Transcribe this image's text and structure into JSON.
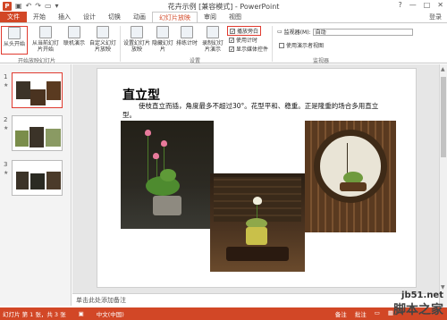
{
  "window": {
    "title": "花卉示例 [兼容模式] - PowerPoint",
    "help": "?",
    "minimize": "—",
    "restore": "□",
    "close": "✕"
  },
  "tabs": [
    {
      "label": "文件"
    },
    {
      "label": "开始"
    },
    {
      "label": "插入"
    },
    {
      "label": "设计"
    },
    {
      "label": "切换"
    },
    {
      "label": "动画"
    },
    {
      "label": "幻灯片放映"
    },
    {
      "label": "审阅"
    },
    {
      "label": "视图"
    }
  ],
  "login": "登录",
  "ribbon": {
    "from_beginning": "从头开始",
    "from_current": "从当前幻灯片开始",
    "online_present": "联机演示",
    "custom_show": "自定义幻灯片放映",
    "setup_show": "设置幻灯片放映",
    "hide_slide": "隐藏幻灯片",
    "rehearse": "排练计时",
    "record": "录制幻灯片演示",
    "play_narration": "播放旁白",
    "use_timings": "使用计时",
    "show_media_controls": "显示媒体控件",
    "monitor_label": "监视器(M):",
    "monitor_value": "自动",
    "presenter_view": "使用演示者视图",
    "group_start": "开始放映幻灯片",
    "group_setup": "设置",
    "group_monitor": "监视器"
  },
  "slides": [
    {
      "num": "1",
      "star": "★"
    },
    {
      "num": "2",
      "star": "★"
    },
    {
      "num": "3",
      "star": "★"
    }
  ],
  "slide": {
    "title": "直立型",
    "body": "使枝直立而插，角度最多不超过30°。花型平和、稳重。正是隆重的场合多用直立型。"
  },
  "notes": "单击此处添加备注",
  "status": {
    "slide_info": "幻灯片 第 1 张，共 3 张",
    "language": "中文(中国)",
    "notes": "备注",
    "comments": "批注"
  },
  "watermark": {
    "line1": "jb51.net",
    "line2": "脚本之家"
  },
  "colors": {
    "accent": "#d24726",
    "highlight": "#e03a2f"
  }
}
